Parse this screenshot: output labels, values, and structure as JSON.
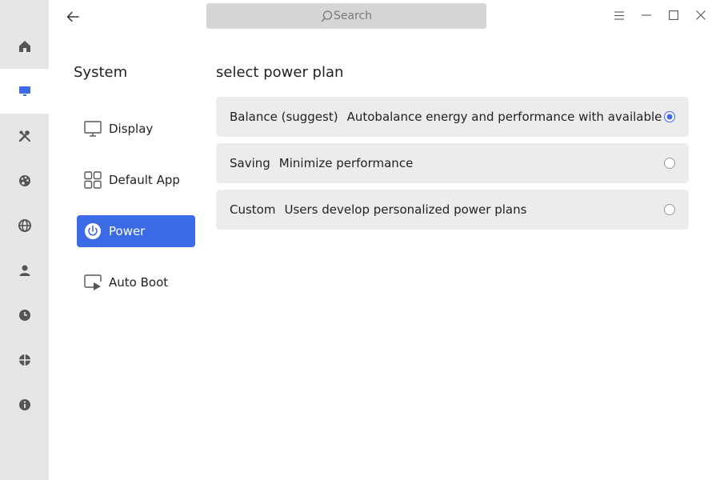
{
  "search": {
    "placeholder": "Search"
  },
  "sidebar": {
    "title": "System",
    "items": [
      {
        "label": "Display",
        "icon": "monitor-icon"
      },
      {
        "label": "Default App",
        "icon": "grid-icon"
      },
      {
        "label": "Power",
        "icon": "power-icon",
        "active": true
      },
      {
        "label": "Auto Boot",
        "icon": "autoboot-icon"
      }
    ]
  },
  "rail": {
    "items": [
      {
        "icon": "home-icon"
      },
      {
        "icon": "system-icon",
        "active": true
      },
      {
        "icon": "tools-icon"
      },
      {
        "icon": "palette-icon"
      },
      {
        "icon": "globe-icon"
      },
      {
        "icon": "user-icon"
      },
      {
        "icon": "clock-icon"
      },
      {
        "icon": "update-icon"
      },
      {
        "icon": "info-icon"
      }
    ]
  },
  "power": {
    "title": "select power plan",
    "plans": [
      {
        "name": "Balance (suggest)",
        "description": "Autobalance energy and performance with available hardware",
        "selected": true
      },
      {
        "name": "Saving",
        "description": "Minimize performance",
        "selected": false
      },
      {
        "name": "Custom",
        "description": "Users develop personalized power plans",
        "selected": false
      }
    ]
  },
  "colors": {
    "accent": "#3d6be5",
    "rail_bg": "#e6e6e6",
    "card_bg": "#ececec",
    "search_bg": "#d6d6d6"
  }
}
